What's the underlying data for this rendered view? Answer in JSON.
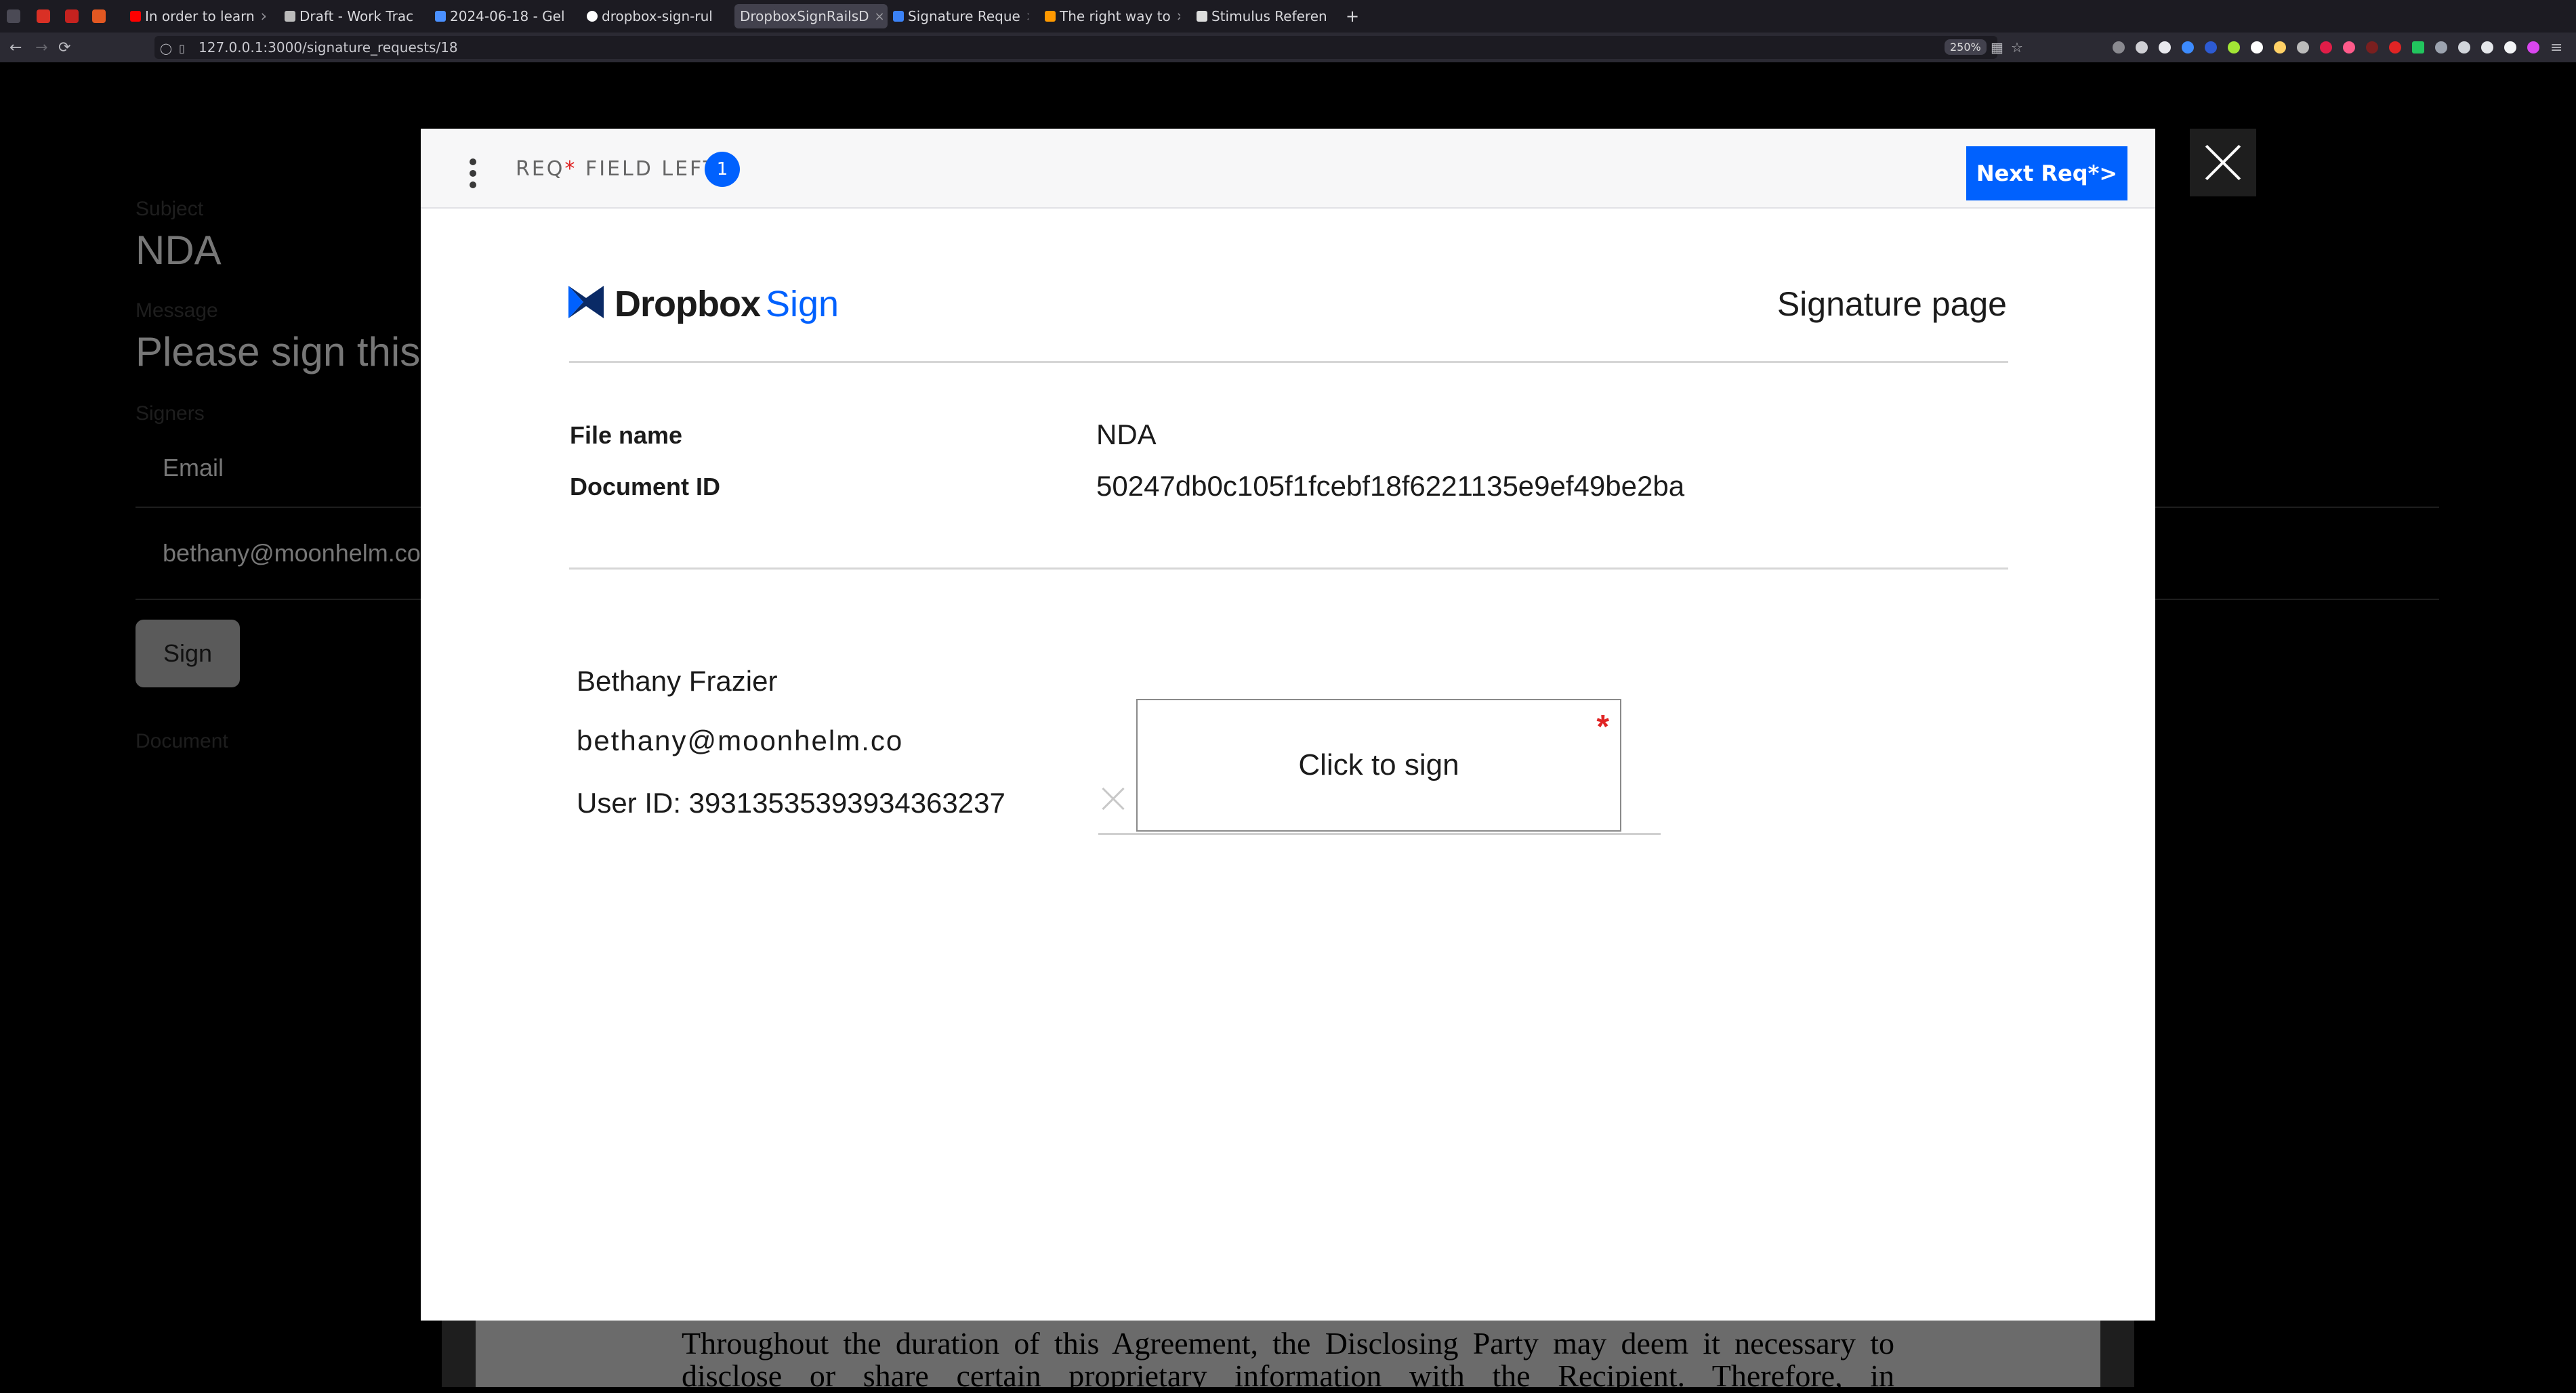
{
  "browser": {
    "tabs": [
      {
        "label": "In order to learn",
        "color": "#ff0000"
      },
      {
        "label": "Draft - Work Trac",
        "color": "#bbbbbb"
      },
      {
        "label": "2024-06-18 - Gel",
        "color": "#4a90ff"
      },
      {
        "label": "dropbox-sign-rul",
        "color": "#ffffff"
      },
      {
        "label": "DropboxSignRailsD",
        "color": "#888888",
        "active": true
      },
      {
        "label": "Signature Reque",
        "color": "#3b82f6"
      },
      {
        "label": "The right way to",
        "color": "#ff9900"
      },
      {
        "label": "Stimulus Referen",
        "color": "#dddddd"
      }
    ],
    "new_tab": "+",
    "url": "127.0.0.1:3000/signature_requests/18",
    "zoom": "250%"
  },
  "background_page": {
    "subject_label": "Subject",
    "subject": "NDA",
    "message_label": "Message",
    "message": "Please sign this",
    "signers_label": "Signers",
    "email_header": "Email",
    "signer_email": "bethany@moonhelm.co",
    "sign_button": "Sign",
    "document_label": "Document",
    "document_text": "Throughout the duration of this Agreement, the Disclosing Party may deem it necessary to disclose or share certain proprietary information with the Recipient. Therefore, in"
  },
  "modal": {
    "header": {
      "req_prefix": "REQ",
      "req_star": "*",
      "req_suffix": " FIELD LEFT",
      "count": "1",
      "next_button": "Next Req*>"
    },
    "brand": {
      "dropbox": "Dropbox",
      "sign": "Sign",
      "accent": "#0061fe"
    },
    "page_title": "Signature page",
    "file_name_label": "File name",
    "file_name": "NDA",
    "document_id_label": "Document ID",
    "document_id": "50247db0c105f1fcebf18f6221135e9ef49be2ba",
    "signer": {
      "name": "Bethany Frazier",
      "email": "bethany@moonhelm.co",
      "user_id": "User ID: 39313535393934363237"
    },
    "sign_field": {
      "label": "Click to sign",
      "required_mark": "*"
    }
  }
}
